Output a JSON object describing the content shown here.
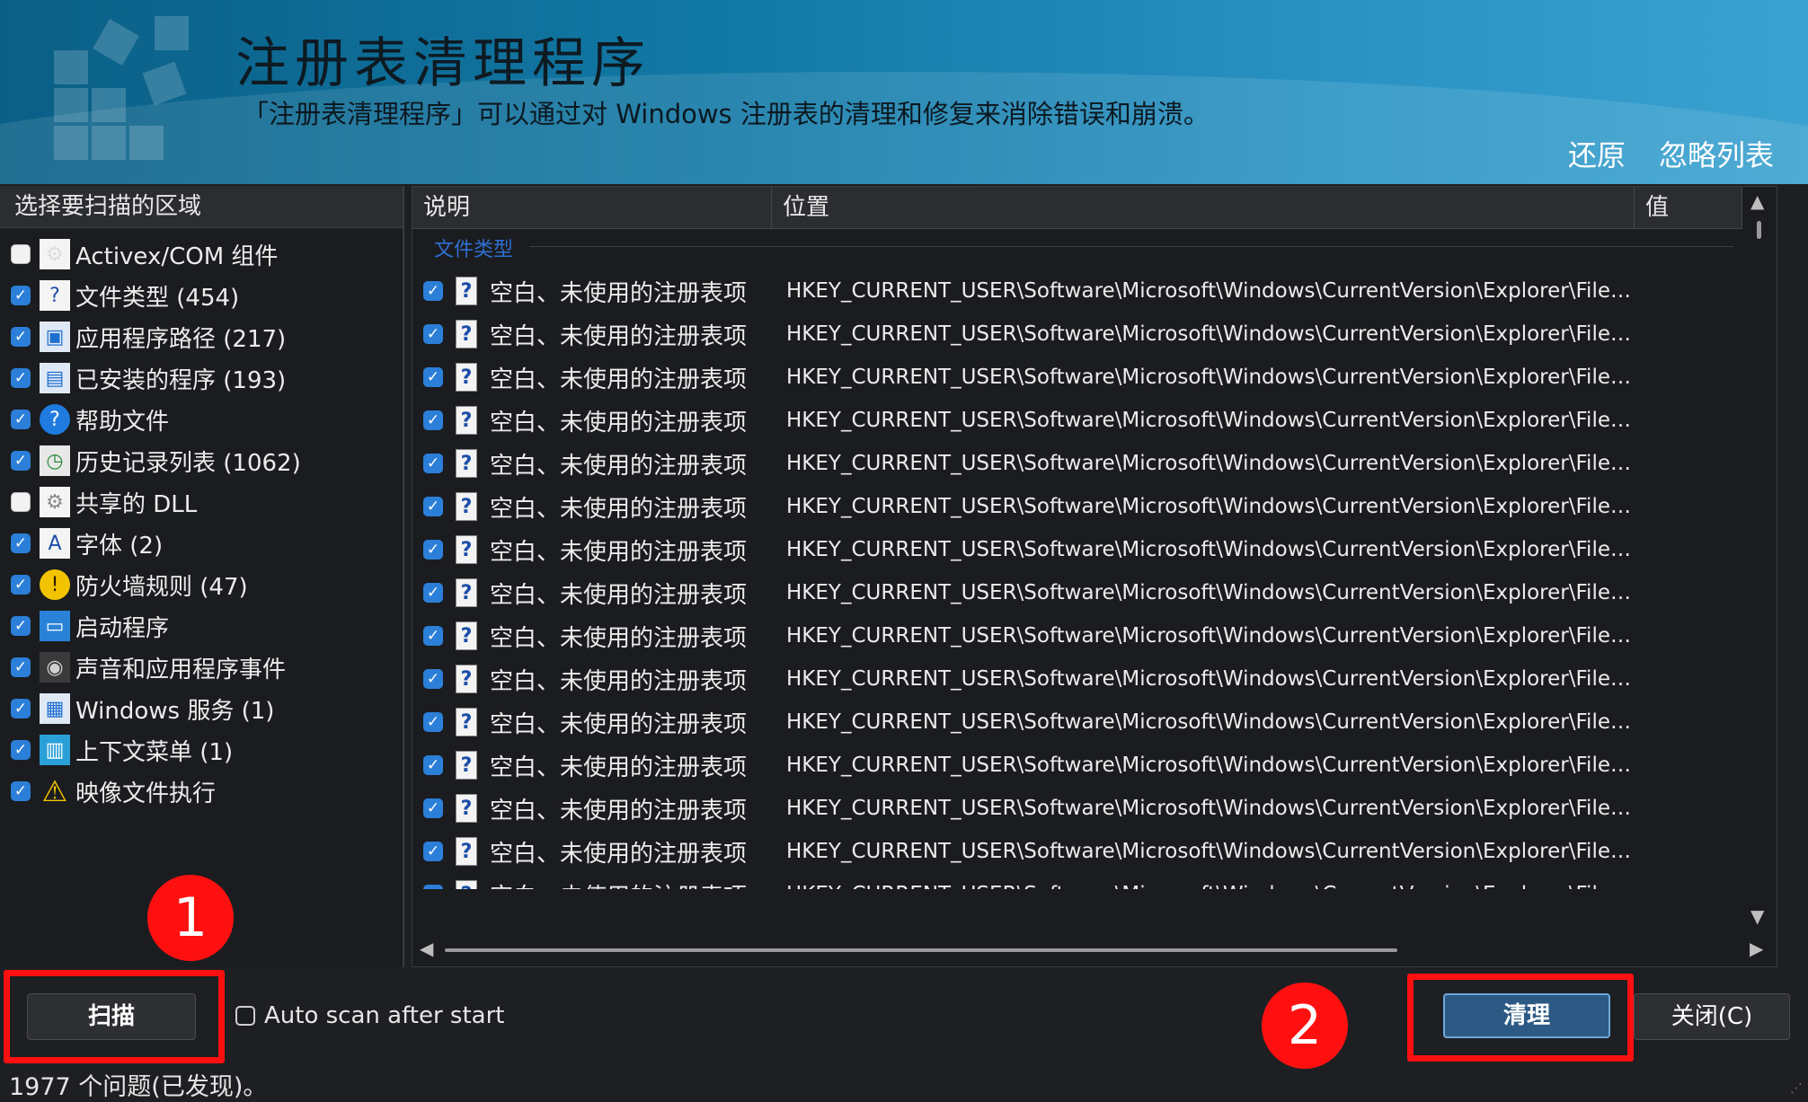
{
  "header": {
    "title": "注册表清理程序",
    "description": "「注册表清理程序」可以通过对 Windows 注册表的清理和修复来消除错误和崩溃。",
    "restore_label": "还原",
    "ignore_list_label": "忽略列表"
  },
  "left_panel": {
    "heading": "选择要扫描的区域",
    "items": [
      {
        "label": "Activex/COM 组件",
        "checked": false,
        "icon": "activex-icon"
      },
      {
        "label": "文件类型 (454)",
        "checked": true,
        "icon": "file-type-icon"
      },
      {
        "label": "应用程序路径 (217)",
        "checked": true,
        "icon": "app-path-icon"
      },
      {
        "label": "已安装的程序 (193)",
        "checked": true,
        "icon": "installed-programs-icon"
      },
      {
        "label": "帮助文件",
        "checked": true,
        "icon": "help-icon"
      },
      {
        "label": "历史记录列表 (1062)",
        "checked": true,
        "icon": "history-icon"
      },
      {
        "label": "共享的 DLL",
        "checked": false,
        "icon": "shared-dll-icon"
      },
      {
        "label": "字体 (2)",
        "checked": true,
        "icon": "font-icon"
      },
      {
        "label": "防火墙规则 (47)",
        "checked": true,
        "icon": "firewall-shield-icon"
      },
      {
        "label": "启动程序",
        "checked": true,
        "icon": "startup-icon"
      },
      {
        "label": "声音和应用程序事件",
        "checked": true,
        "icon": "sound-icon"
      },
      {
        "label": "Windows 服务 (1)",
        "checked": true,
        "icon": "services-icon"
      },
      {
        "label": "上下文菜单 (1)",
        "checked": true,
        "icon": "context-menu-icon"
      },
      {
        "label": "映像文件执行",
        "checked": true,
        "icon": "warning-icon"
      }
    ]
  },
  "table": {
    "columns": [
      "说明",
      "位置",
      "值"
    ],
    "group_label": "文件类型",
    "row_description": "空白、未使用的注册表项",
    "row_location": "HKEY_CURRENT_USER\\Software\\Microsoft\\Windows\\CurrentVersion\\Explorer\\FileExts\\...",
    "visible_row_count": 16
  },
  "footer": {
    "scan_label": "扫描",
    "auto_scan_label": "Auto scan after start",
    "clean_label": "清理",
    "close_label": "关闭(C)",
    "status": "1977 个问题(已发现)。",
    "badge_1": "1",
    "badge_2": "2"
  },
  "colors": {
    "header_start": "#0a5f86",
    "header_end": "#3aa2d0",
    "checkbox_accent": "#2b7fd8",
    "highlight_red": "#ff1010",
    "clean_button": "#2c5a85"
  }
}
